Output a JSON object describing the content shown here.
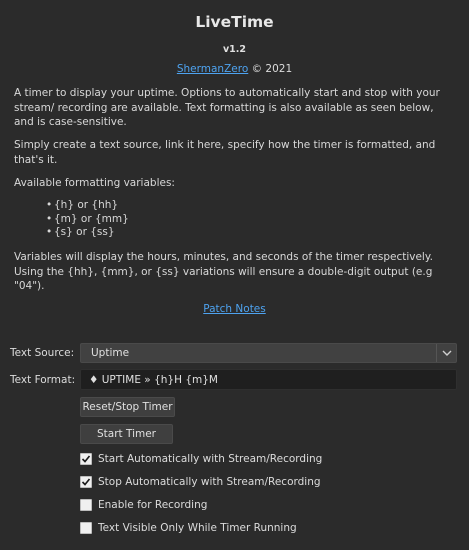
{
  "header": {
    "title": "LiveTime",
    "version": "v1.2",
    "author_link": "ShermanZero",
    "copyright": "© 2021"
  },
  "description": {
    "intro": "A timer to display your uptime. Options to automatically start and stop with your stream/ recording are available. Text formatting is also available as seen below, and is case-sensitive.",
    "instructions": "Simply create a text source, link it here, specify how the timer is formatted, and that's it.",
    "variables_heading": "Available formatting variables:",
    "variables": [
      "{h} or {hh}",
      "{m} or {mm}",
      "{s} or {ss}"
    ],
    "variables_note": "Variables will display the hours, minutes, and seconds of the timer respectively. Using the {hh}, {mm}, or {ss} variations will ensure a double-digit output (e.g \"04\")."
  },
  "patch_notes_link": "Patch Notes",
  "form": {
    "text_source_label": "Text Source:",
    "text_source_value": "Uptime",
    "text_format_label": "Text Format:",
    "text_format_value": "♦ UPTIME  »  {h}H  {m}M",
    "reset_button": "Reset/Stop Timer",
    "start_button": "Start Timer"
  },
  "checkboxes": [
    {
      "label": "Start Automatically with Stream/Recording",
      "checked": true
    },
    {
      "label": "Stop Automatically with Stream/Recording",
      "checked": true
    },
    {
      "label": "Enable for Recording",
      "checked": false
    },
    {
      "label": "Text Visible Only While Timer Running",
      "checked": false
    }
  ],
  "colors": {
    "background": "#2b2b2b",
    "link": "#4ea3f0",
    "input_bg": "#1f1f1f",
    "button_bg": "#3f3f3f"
  }
}
